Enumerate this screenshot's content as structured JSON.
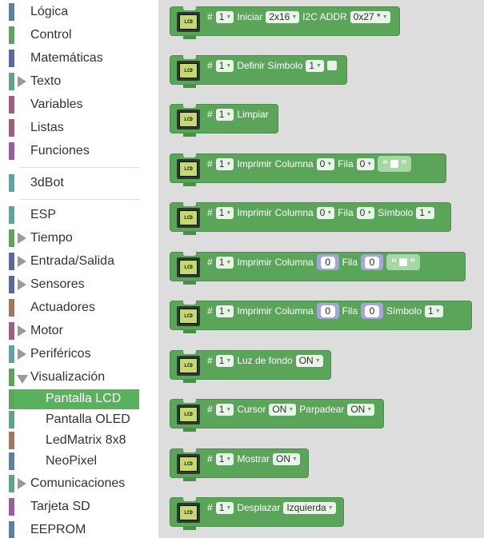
{
  "toolbox": {
    "categories": [
      {
        "label": "Lógica",
        "color": "#5b80a5",
        "arrow": false
      },
      {
        "label": "Control",
        "color": "#5ba55b",
        "arrow": false
      },
      {
        "label": "Matemáticas",
        "color": "#5b67a5",
        "arrow": false
      },
      {
        "label": "Texto",
        "color": "#5ba58c",
        "arrow": true
      },
      {
        "label": "Variables",
        "color": "#a55b80",
        "arrow": false
      },
      {
        "label": "Listas",
        "color": "#a55b80",
        "arrow": false
      },
      {
        "label": "Funciones",
        "color": "#995ba5",
        "arrow": false
      },
      {
        "label": "3dBot",
        "color": "#5ba5a5",
        "arrow": false
      },
      {
        "label": "ESP",
        "color": "#5ba5a5",
        "arrow": false
      },
      {
        "label": "Tiempo",
        "color": "#5ba55b",
        "arrow": true
      },
      {
        "label": "Entrada/Salida",
        "color": "#5b67a5",
        "arrow": true
      },
      {
        "label": "Sensores",
        "color": "#5b67a5",
        "arrow": true
      },
      {
        "label": "Actuadores",
        "color": "#a5745b",
        "arrow": false
      },
      {
        "label": "Motor",
        "color": "#a55b80",
        "arrow": true
      },
      {
        "label": "Periféricos",
        "color": "#5ba5a5",
        "arrow": true
      },
      {
        "label": "Visualización",
        "color": "#5ba55b",
        "arrow": "open"
      },
      {
        "label": "Comunicaciones",
        "color": "#5ba58c",
        "arrow": true
      },
      {
        "label": "Tarjeta SD",
        "color": "#995ba5",
        "arrow": false
      },
      {
        "label": "EEPROM",
        "color": "#5b80a5",
        "arrow": false
      }
    ],
    "subcategories": [
      {
        "label": "Pantalla LCD",
        "color": "#5ba55b",
        "selected": true
      },
      {
        "label": "Pantalla OLED",
        "color": "#5ba58c",
        "selected": false
      },
      {
        "label": "LedMatrix 8x8",
        "color": "#a5745b",
        "selected": false
      },
      {
        "label": "NeoPixel",
        "color": "#5b80a5",
        "selected": false
      }
    ]
  },
  "flyout": {
    "lcd_icon_text": "LCD",
    "hash": "#",
    "blocks": {
      "iniciar": {
        "num": "1",
        "label": "Iniciar",
        "size": "2x16",
        "i2c": "I2C ADDR",
        "addr": "0x27 *"
      },
      "definir": {
        "num": "1",
        "label": "Definir Símbolo",
        "sym": "1"
      },
      "limpiar": {
        "num": "1",
        "label": "Limpiar"
      },
      "imprimir1": {
        "num": "1",
        "label": "Imprimir",
        "col": "Columna",
        "colv": "0",
        "fila": "Fila",
        "filav": "0"
      },
      "imprimir2": {
        "num": "1",
        "label": "Imprimir",
        "col": "Columna",
        "colv": "0",
        "fila": "Fila",
        "filav": "0",
        "simbolo": "Símbolo",
        "simv": "1"
      },
      "imprimir3": {
        "num": "1",
        "label": "Imprimir",
        "col": "Columna",
        "colv": "0",
        "fila": "Fila",
        "filav": "0"
      },
      "imprimir4": {
        "num": "1",
        "label": "Imprimir",
        "col": "Columna",
        "colv": "0",
        "fila": "Fila",
        "filav": "0",
        "simbolo": "Símbolo",
        "simv": "1"
      },
      "luz": {
        "num": "1",
        "label": "Luz de fondo",
        "val": "ON"
      },
      "cursor": {
        "num": "1",
        "label": "Cursor",
        "val": "ON",
        "parp": "Parpadear",
        "parpv": "ON"
      },
      "mostrar": {
        "num": "1",
        "label": "Mostrar",
        "val": "ON"
      },
      "desplazar": {
        "num": "1",
        "label": "Desplazar",
        "val": "Izquierda"
      }
    }
  }
}
